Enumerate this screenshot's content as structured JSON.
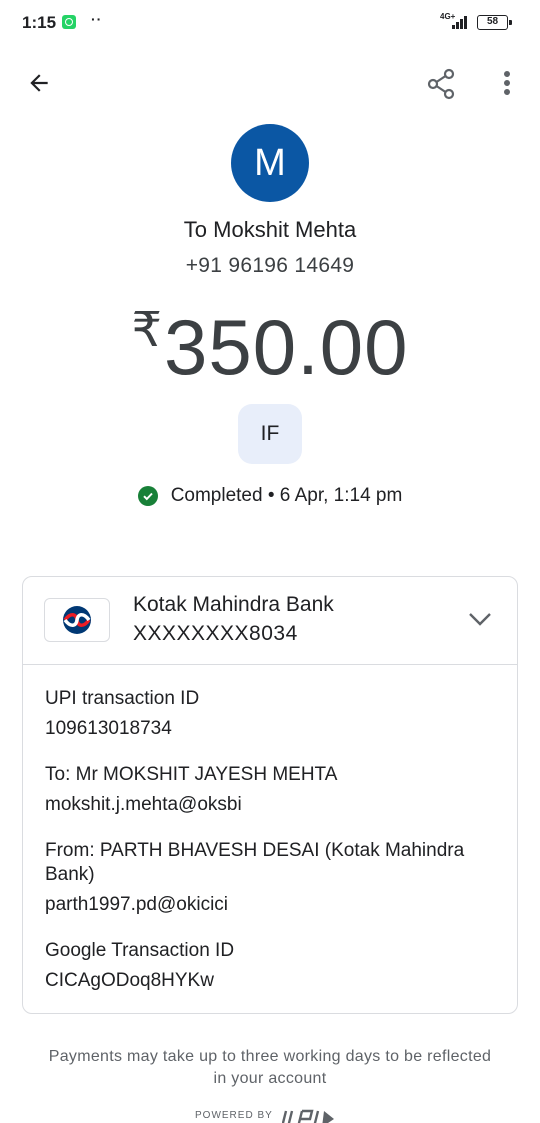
{
  "status_bar": {
    "time": "1:15",
    "network": "4G+",
    "battery": "58"
  },
  "icons": {
    "back": "arrow-back-icon",
    "share": "share-icon",
    "more": "more-vert-icon",
    "status": "check-circle-icon",
    "expand": "chevron-down-icon"
  },
  "payee": {
    "avatar_letter": "M",
    "name": "To Mokshit Mehta",
    "phone": "+91 96196 14649"
  },
  "payment": {
    "currency": "₹",
    "amount": "350.00",
    "badge": "IF",
    "status": "Completed • 6 Apr, 1:14 pm"
  },
  "bank": {
    "name": "Kotak Mahindra Bank",
    "account": "XXXXXXXX8034"
  },
  "details": [
    {
      "label": "UPI transaction ID",
      "value": "109613018734"
    },
    {
      "label": "To: Mr MOKSHIT JAYESH MEHTA",
      "value": "mokshit.j.mehta@oksbi"
    },
    {
      "label": "From: PARTH BHAVESH DESAI (Kotak Mahindra Bank)",
      "value": "parth1997.pd@okicici"
    },
    {
      "label": "Google Transaction ID",
      "value": "CICAgODoq8HYKw"
    }
  ],
  "footer": {
    "note": "Payments may take up to three working days to be reflected in your account",
    "powered_by": "POWERED BY"
  },
  "colors": {
    "avatar_bg": "#0b57a4",
    "badge_bg": "#e8eefa",
    "success": "#188038",
    "kotak_red": "#ed1c24",
    "kotak_blue": "#003874"
  }
}
